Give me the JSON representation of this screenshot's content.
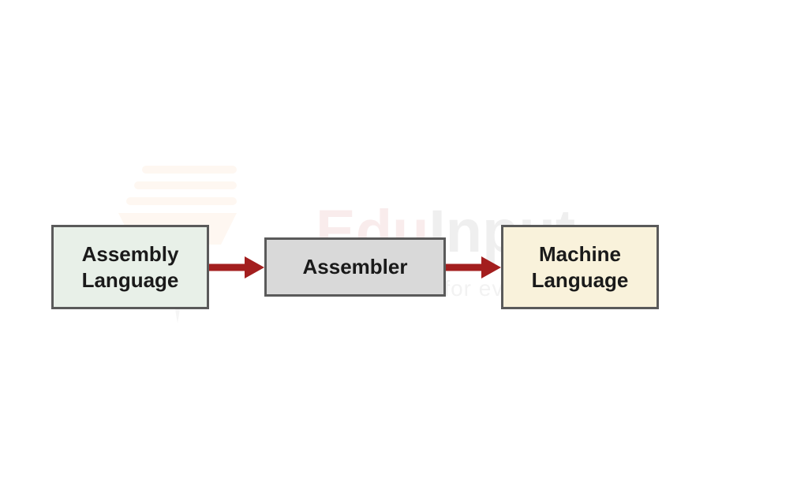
{
  "watermark": {
    "brand_part1": "Edu",
    "brand_part2": "Input",
    "tagline": "Education for everyone"
  },
  "diagram": {
    "box1_line1": "Assembly",
    "box1_line2": "Language",
    "box2": "Assembler",
    "box3_line1": "Machine",
    "box3_line2": "Language",
    "arrow_color": "#a31e1e"
  }
}
